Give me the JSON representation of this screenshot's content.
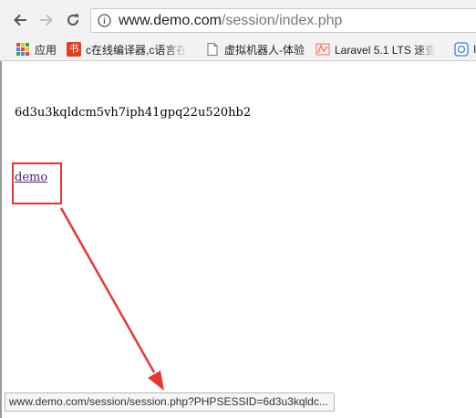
{
  "browser": {
    "url_host": "www.demo.com",
    "url_path": "/session/index.php"
  },
  "bookmarks": [
    {
      "label": "应用",
      "icon": "apps-grid-icon"
    },
    {
      "label": "c在线编译器,c语言在",
      "icon": "book-icon",
      "icon_text": "书",
      "icon_color": "#e0401a"
    },
    {
      "label": "虚拟机器人-体验",
      "icon": "page-icon"
    },
    {
      "label": "Laravel 5.1 LTS 速查",
      "icon": "laravel-icon"
    },
    {
      "label": "I",
      "icon": "link-icon"
    }
  ],
  "page": {
    "session_id": "6d3u3kqldcm5vh7iph41gpq22u520hb2",
    "link_text": "demo"
  },
  "status_bar": {
    "text": "www.demo.com/session/session.php?PHPSESSID=6d3u3kqldc..."
  },
  "colors": {
    "annotation": "#e8372f",
    "visited_link": "#551a8b"
  }
}
